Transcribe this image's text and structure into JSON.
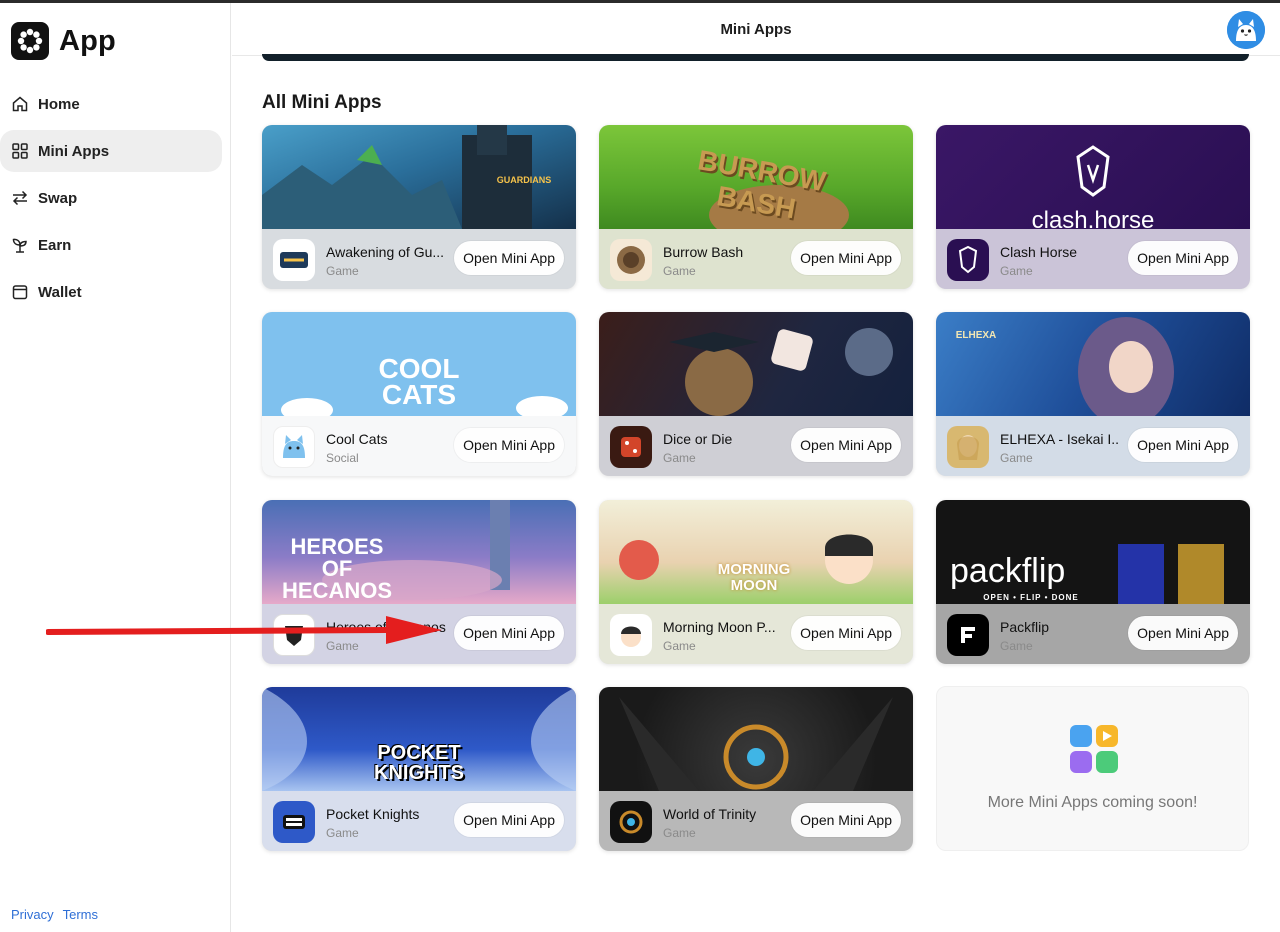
{
  "app": {
    "name": "App"
  },
  "sidebar": {
    "items": [
      {
        "label": "Home",
        "icon": "home-icon"
      },
      {
        "label": "Mini Apps",
        "icon": "grid-icon",
        "active": true
      },
      {
        "label": "Swap",
        "icon": "swap-icon"
      },
      {
        "label": "Earn",
        "icon": "sprout-icon"
      },
      {
        "label": "Wallet",
        "icon": "wallet-icon"
      }
    ],
    "footer": {
      "privacy": "Privacy",
      "terms": "Terms"
    }
  },
  "header": {
    "title": "Mini Apps"
  },
  "main": {
    "section_title": "All Mini Apps",
    "open_label": "Open Mini App",
    "cards": [
      {
        "name": "Awakening of Gu...",
        "category": "Game",
        "art_text": "GUARDIANS"
      },
      {
        "name": "Burrow Bash",
        "category": "Game",
        "art_text": "BURROW BASH"
      },
      {
        "name": "Clash Horse",
        "category": "Game",
        "art_text": "clash.horse"
      },
      {
        "name": "Cool Cats",
        "category": "Social",
        "art_text": "COOL CATS"
      },
      {
        "name": "Dice or Die",
        "category": "Game",
        "art_text": ""
      },
      {
        "name": "ELHEXA - Isekai I...",
        "category": "Game",
        "art_text": "ELHEXA"
      },
      {
        "name": "Heroes of Hecanos",
        "category": "Game",
        "art_text": "HEROES OF HECANOS"
      },
      {
        "name": "Morning Moon P...",
        "category": "Game",
        "art_text": "MORNING MOON"
      },
      {
        "name": "Packflip",
        "category": "Game",
        "art_text": "packflip",
        "art_subtext": "OPEN • FLIP • DONE"
      },
      {
        "name": "Pocket Knights",
        "category": "Game",
        "art_text": "POCKET KNIGHTS"
      },
      {
        "name": "World of Trinity",
        "category": "Game",
        "art_text": ""
      }
    ],
    "coming_soon": "More Mini Apps coming soon!"
  },
  "colors": {
    "accent": "#2f8de4",
    "arrow": "#e41e1e",
    "active_bg": "#eeeeee"
  }
}
